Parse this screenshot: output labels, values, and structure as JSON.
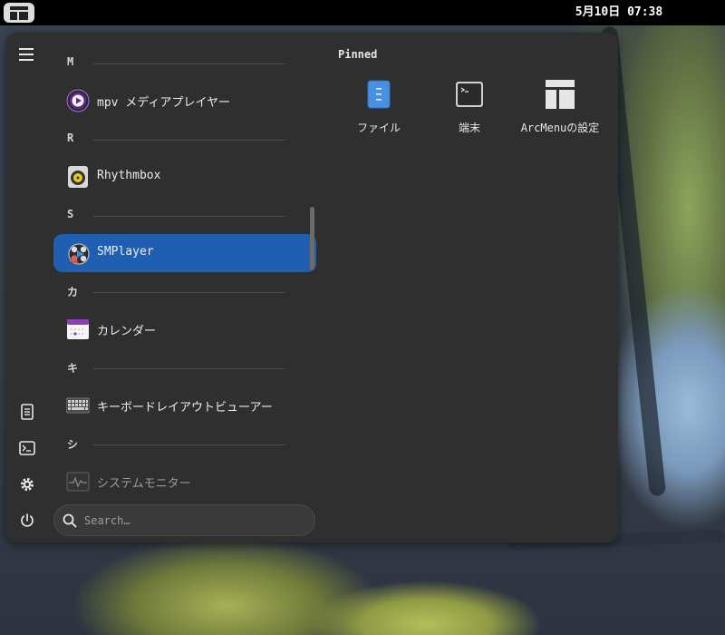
{
  "topbar": {
    "clock": "5月10日 07:38"
  },
  "menu": {
    "pinned_title": "Pinned",
    "pinned": [
      {
        "label": "ファイル",
        "icon": "files-icon"
      },
      {
        "label": "端末",
        "icon": "terminal-icon"
      },
      {
        "label": "ArcMenuの設定",
        "icon": "arcmenu-settings-icon"
      }
    ],
    "apps": [
      {
        "kind": "header",
        "text": "M"
      },
      {
        "kind": "app",
        "label": "mpv メディアプレイヤー",
        "icon": "mpv-icon"
      },
      {
        "kind": "header",
        "text": "R"
      },
      {
        "kind": "app",
        "label": "Rhythmbox",
        "icon": "rhythmbox-icon"
      },
      {
        "kind": "header",
        "text": "S"
      },
      {
        "kind": "app",
        "label": "SMPlayer",
        "icon": "smplayer-icon",
        "selected": true
      },
      {
        "kind": "header",
        "text": "カ"
      },
      {
        "kind": "app",
        "label": "カレンダー",
        "icon": "calendar-icon"
      },
      {
        "kind": "header",
        "text": "キ"
      },
      {
        "kind": "app",
        "label": "キーボードレイアウトビューアー",
        "icon": "keyboard-icon"
      },
      {
        "kind": "header",
        "text": "シ"
      },
      {
        "kind": "app",
        "label": "システムモニター",
        "icon": "system-monitor-icon"
      }
    ],
    "sidebar_icons": [
      "documents-icon",
      "terminal-icon",
      "settings-icon",
      "power-icon"
    ],
    "search": {
      "placeholder": "Search…"
    }
  },
  "colors": {
    "selection": "#1f5fb2",
    "panel": "#2f2f2f"
  }
}
